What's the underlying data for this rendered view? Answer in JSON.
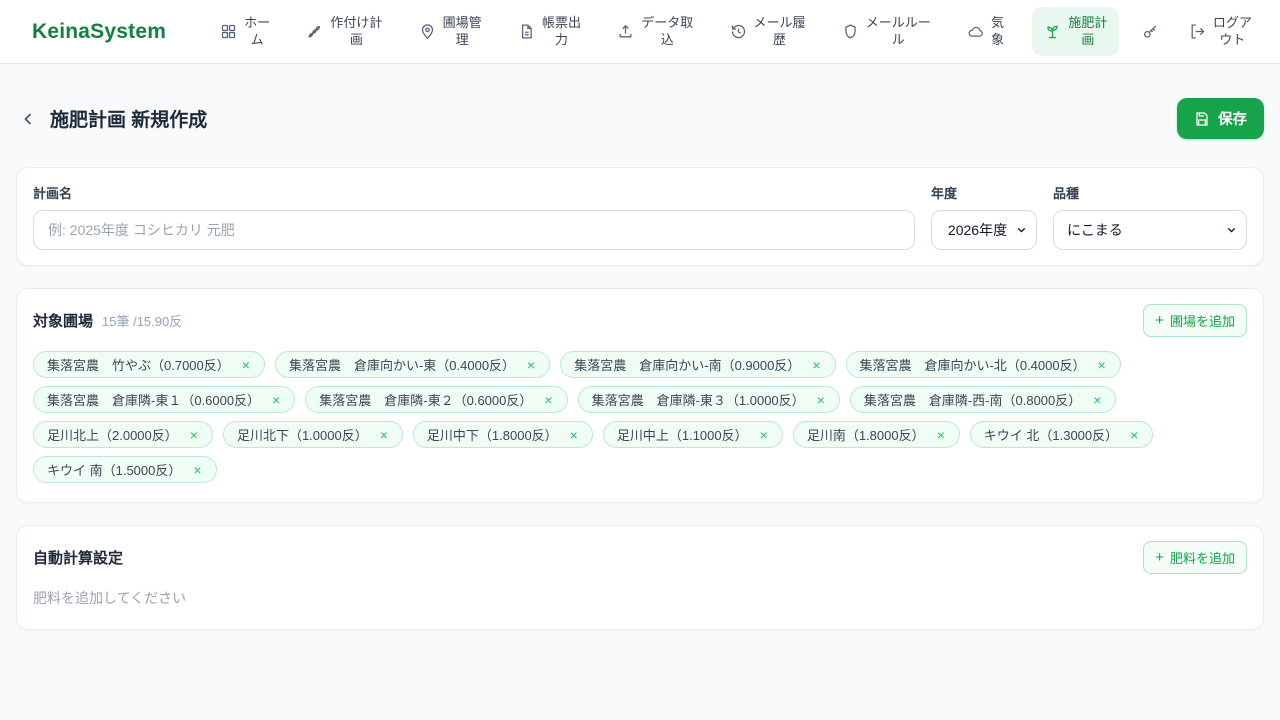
{
  "brand": "KeinaSystem",
  "nav": {
    "items": [
      {
        "icon": "grid-icon",
        "lines": [
          "ホー",
          "ム"
        ]
      },
      {
        "icon": "wheat-icon",
        "lines": [
          "作付け計",
          "画"
        ]
      },
      {
        "icon": "map-pin-icon",
        "lines": [
          "圃場管",
          "理"
        ]
      },
      {
        "icon": "document-icon",
        "lines": [
          "帳票出",
          "力"
        ]
      },
      {
        "icon": "upload-icon",
        "lines": [
          "データ取",
          "込"
        ]
      },
      {
        "icon": "history-icon",
        "lines": [
          "メール履",
          "歴"
        ]
      },
      {
        "icon": "shield-icon",
        "lines": [
          "メールルー",
          "ル"
        ]
      },
      {
        "icon": "cloud-icon",
        "lines": [
          "気",
          "象"
        ]
      },
      {
        "icon": "sprout-icon",
        "lines": [
          "施肥計",
          "画"
        ],
        "active": true
      },
      {
        "icon": "key-icon",
        "lines": [
          "",
          ""
        ]
      },
      {
        "icon": "logout-icon",
        "lines": [
          "ログア",
          "ウト"
        ]
      }
    ]
  },
  "page": {
    "title": "施肥計画 新規作成",
    "save_label": "保存"
  },
  "form": {
    "plan_name_label": "計画名",
    "plan_name_value": "",
    "plan_name_placeholder": "例: 2025年度 コシヒカリ 元肥",
    "year_label": "年度",
    "year_value": "2026年度",
    "variety_label": "品種",
    "variety_value": "にこまる"
  },
  "fields_section": {
    "title": "対象圃場",
    "summary": "15筆 /15.90反",
    "add_label": "圃場を追加",
    "chips": [
      {
        "label": "集落宮農　竹やぶ（0.7000反）"
      },
      {
        "label": "集落宮農　倉庫向かい-東（0.4000反）"
      },
      {
        "label": "集落宮農　倉庫向かい-南（0.9000反）"
      },
      {
        "label": "集落宮農　倉庫向かい-北（0.4000反）"
      },
      {
        "label": "集落宮農　倉庫隣-東１（0.6000反）"
      },
      {
        "label": "集落宮農　倉庫隣-東２（0.6000反）"
      },
      {
        "label": "集落宮農　倉庫隣-東３（1.0000反）"
      },
      {
        "label": "集落宮農　倉庫隣-西-南（0.8000反）"
      },
      {
        "label": "足川北上（2.0000反）"
      },
      {
        "label": "足川北下（1.0000反）"
      },
      {
        "label": "足川中下（1.8000反）"
      },
      {
        "label": "足川中上（1.1000反）"
      },
      {
        "label": "足川南（1.8000反）"
      },
      {
        "label": "キウイ 北（1.3000反）"
      },
      {
        "label": "キウイ 南（1.5000反）"
      }
    ]
  },
  "auto_calc": {
    "title": "自動計算設定",
    "empty_message": "肥料を追加してください",
    "add_label": "肥料を追加"
  },
  "icons": {
    "plus": "+",
    "close": "×"
  },
  "colors": {
    "brand_green": "#15803d",
    "accent_green": "#16a34a",
    "active_nav_bg": "#e9f8ef",
    "chip_bg": "#f0fdf4",
    "chip_border": "#bce9cb",
    "chip_close": "#22c55e",
    "page_bg": "#f8fafc",
    "card_border": "#e9edf2",
    "text_dark": "#1e293b",
    "text_muted": "#94a3b8"
  }
}
